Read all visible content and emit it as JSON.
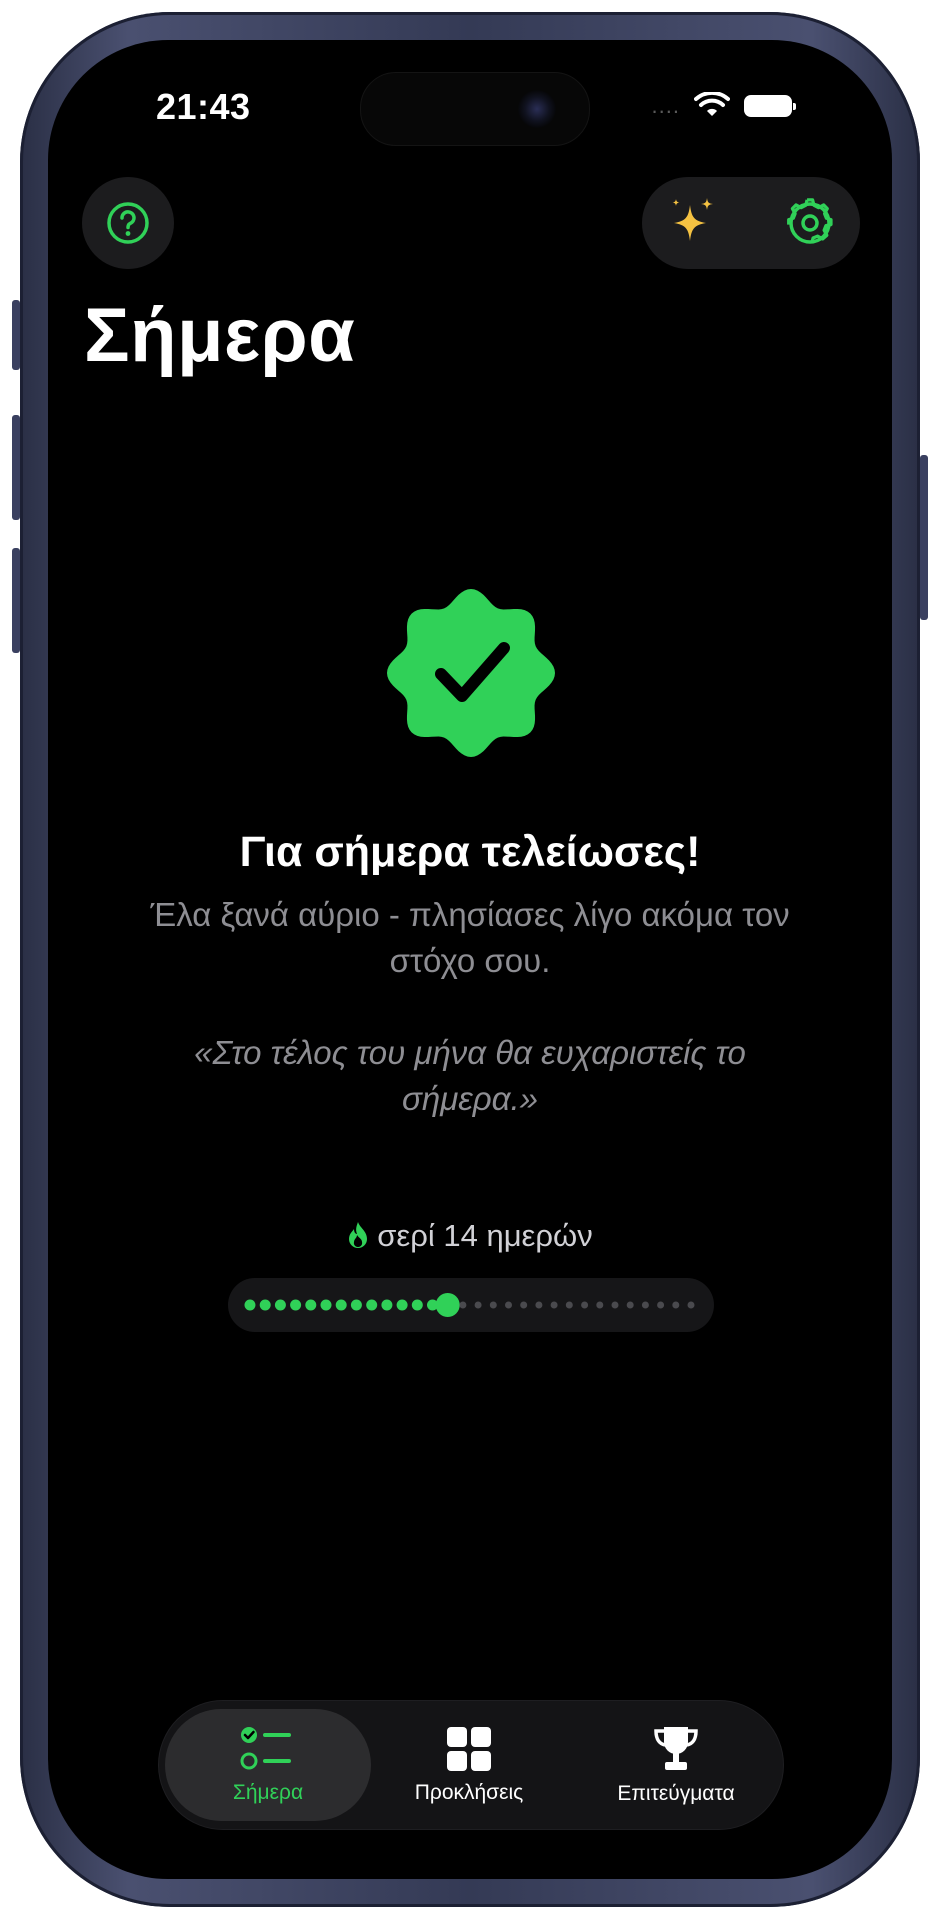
{
  "status_bar": {
    "time": "21:43",
    "signal": "....",
    "icons": [
      "wifi-icon",
      "battery-icon"
    ]
  },
  "header": {
    "help_icon": "question-mark-circle-icon",
    "sparkle_icon": "sparkles-icon",
    "settings_icon": "gear-icon",
    "title": "Σήμερα"
  },
  "completion": {
    "badge_icon": "checkmark-seal-icon",
    "headline": "Για σήμερα τελείωσες!",
    "message": "Έλα ξανά αύριο - πλησίασες λίγο ακόμα τον στόχο σου.",
    "quote": "«Στο τέλος του μήνα θα ευχαριστείς το σήμερα.»"
  },
  "streak": {
    "icon": "flame-icon",
    "label": "σερί 14 ημερών",
    "completed_days": 14,
    "total_days": 30
  },
  "bottom_nav": {
    "tabs": [
      {
        "label": "Σήμερα",
        "icon": "checklist-icon",
        "active": true
      },
      {
        "label": "Προκλήσεις",
        "icon": "grid-icon",
        "active": false
      },
      {
        "label": "Επιτεύγματα",
        "icon": "trophy-icon",
        "active": false
      }
    ]
  },
  "colors": {
    "accent": "#30d158",
    "gold": "#f5c242",
    "background": "#000000",
    "surface": "#1c1c1e",
    "muted_text": "#8e8e93"
  }
}
